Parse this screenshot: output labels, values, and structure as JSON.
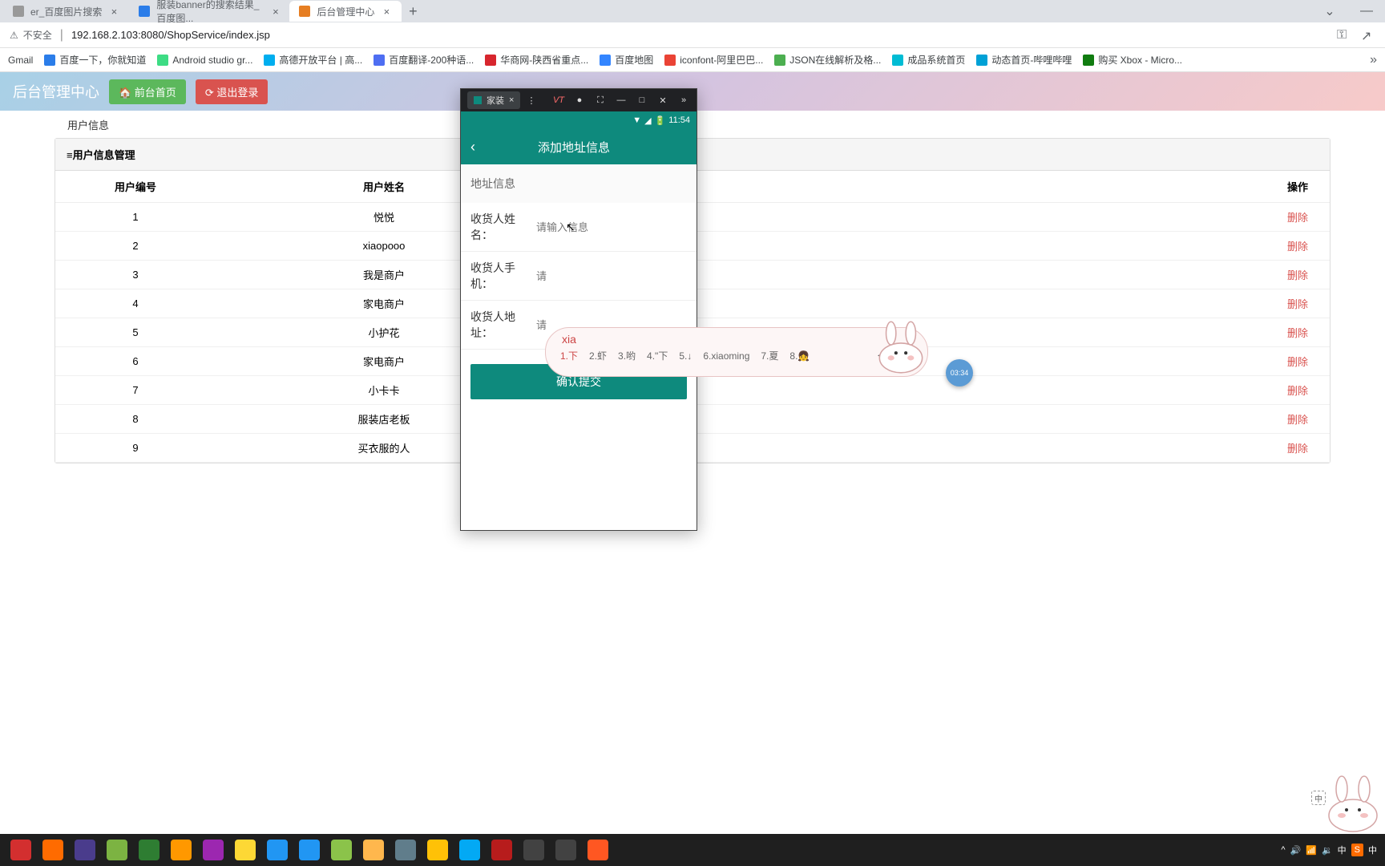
{
  "browser": {
    "tabs": [
      {
        "title": "er_百度图片搜索"
      },
      {
        "title": "服装banner的搜索结果_百度图..."
      },
      {
        "title": "后台管理中心"
      }
    ],
    "security_label": "不安全",
    "url": "192.168.2.103:8080/ShopService/index.jsp",
    "bookmarks": [
      {
        "label": "Gmail"
      },
      {
        "label": "百度一下，你就知道"
      },
      {
        "label": "Android studio gr..."
      },
      {
        "label": "高德开放平台 | 高..."
      },
      {
        "label": "百度翻译-200种语..."
      },
      {
        "label": "华商网-陕西省重点..."
      },
      {
        "label": "百度地图"
      },
      {
        "label": "iconfont-阿里巴巴..."
      },
      {
        "label": "JSON在线解析及格..."
      },
      {
        "label": "成品系统首页"
      },
      {
        "label": "动态首页-哔哩哔哩"
      },
      {
        "label": "购买 Xbox - Micro..."
      }
    ]
  },
  "page": {
    "title": "后台管理中心",
    "btn_home": "🏠 前台首页",
    "btn_logout": "⟳ 退出登录",
    "sub_nav": "用户信息",
    "panel_title": "≡用户信息管理",
    "table": {
      "headers": {
        "id": "用户编号",
        "name": "用户姓名",
        "action": "操作"
      },
      "rows": [
        {
          "id": "1",
          "name": "悦悦"
        },
        {
          "id": "2",
          "name": "xiaopooo"
        },
        {
          "id": "3",
          "name": "我是商户"
        },
        {
          "id": "4",
          "name": "家电商户"
        },
        {
          "id": "5",
          "name": "小护花"
        },
        {
          "id": "6",
          "name": "家电商户"
        },
        {
          "id": "7",
          "name": "小卡卡"
        },
        {
          "id": "8",
          "name": "服装店老板"
        },
        {
          "id": "9",
          "name": "买衣服的人"
        }
      ],
      "delete_label": "删除"
    }
  },
  "emulator": {
    "tab_label": "家装",
    "status_time": "11:54",
    "header_title": "添加地址信息",
    "section_title": "地址信息",
    "form": {
      "name_label": "收货人姓名：",
      "name_placeholder": "请输入信息",
      "phone_label": "收货人手机：",
      "phone_placeholder": "请",
      "addr_label": "收货人地址：",
      "addr_placeholder": "请"
    },
    "submit_label": "确认提交"
  },
  "ime": {
    "input": "xia",
    "candidates": [
      "1.下",
      "2.虾",
      "3.哟",
      "4.\"下",
      "5.↓",
      "6.xiaoming",
      "7.夏",
      "8.👧"
    ]
  },
  "timer": "03:34",
  "mascot_label": "中",
  "taskbar_icons": [
    "#d32f2f",
    "#ff6b00",
    "#4a3c8c",
    "#7cb342",
    "#2e7d32",
    "#ff9800",
    "#9c27b0",
    "#fdd835",
    "#2196f3",
    "#2196f3",
    "#8bc34a",
    "#ffb74d",
    "#607d8b",
    "#ffc107",
    "#03a9f4",
    "#b71c1c",
    "#424242",
    "#424242",
    "#ff5722"
  ],
  "tray": {
    "lang1": "中",
    "lang2": "中"
  }
}
